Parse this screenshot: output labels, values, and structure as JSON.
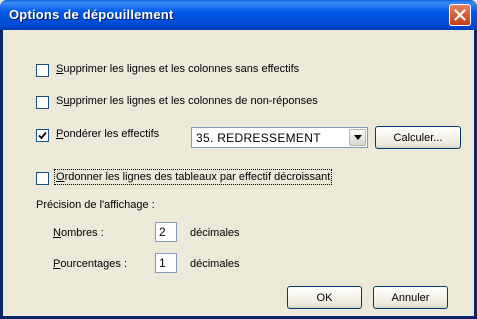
{
  "window": {
    "title": "Options de dépouillement"
  },
  "options": [
    {
      "label": "Supprimer les lignes et les colonnes sans effectifs",
      "checked": false
    },
    {
      "label": "Supprimer les lignes et les colonnes de non-réponses",
      "checked": false
    },
    {
      "label": "Pondérer les effectifs",
      "checked": true
    },
    {
      "label": "Ordonner les lignes des tableaux par effectif décroissant",
      "checked": false
    }
  ],
  "weight": {
    "selected": "35. REDRESSEMENT",
    "calculate_label": "Calculer..."
  },
  "precision": {
    "heading": "Précision de l'affichage :",
    "numbers_label": "Nombres :",
    "numbers_value": "2",
    "numbers_unit": "décimales",
    "percent_label": "Pourcentages :",
    "percent_value": "1",
    "percent_unit": "décimales"
  },
  "buttons": {
    "ok": "OK",
    "cancel": "Annuler"
  },
  "colors": {
    "titlebar": "#0058e8",
    "close": "#d9532c",
    "background": "#ece9d8"
  },
  "icons": {
    "close": "close-icon",
    "dropdown": "chevron-down-icon",
    "check": "check-icon"
  }
}
